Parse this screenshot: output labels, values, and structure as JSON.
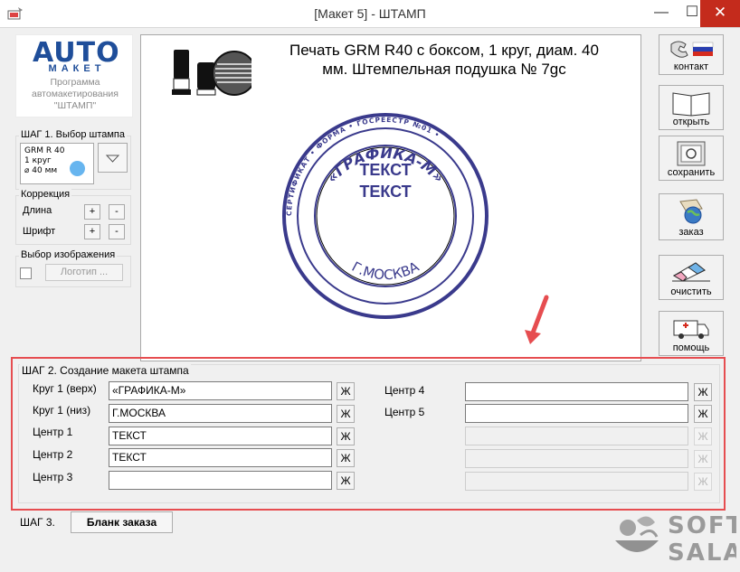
{
  "window": {
    "title": "[Макет 5] - ШТАМП",
    "minimize": "—",
    "maximize": "☐",
    "close": "✕"
  },
  "logo": {
    "auto": "AUTO",
    "maket": "МАКЕТ",
    "sub": "Программа автомакетирования \"ШТАМП\""
  },
  "step1": {
    "title": "ШАГ 1. Выбор штампа",
    "stamp_lines": [
      "GRM R 40",
      "1 круг",
      "⌀ 40 мм"
    ]
  },
  "correction": {
    "title": "Коррекция",
    "length_label": "Длина",
    "font_label": "Шрифт",
    "plus": "+",
    "minus": "-"
  },
  "image_select": {
    "title": "Выбор изображения",
    "logo_button": "Логотип ..."
  },
  "preview": {
    "title": "Печать GRM R40 с боксом, 1 круг, диам. 40 мм. Штемпельная подушка № 7gc",
    "stamp_top_text": "«ГРАФИКА-М»",
    "stamp_bottom_text": "Г.МОСКВА",
    "stamp_center_1": "ТЕКСТ",
    "stamp_center_2": "ТЕКСТ",
    "ring_text": "СЕРТИФИКАТ • ФОРМА • ГОСРЕЕСТР №01 •",
    "stamp_color": "#3a3a8c"
  },
  "right_buttons": {
    "contact": "контакт",
    "open": "открыть",
    "save": "сохранить",
    "order": "заказ",
    "clear": "очистить",
    "help": "помощь"
  },
  "step2": {
    "title": "ШАГ 2. Создание макета штампа",
    "bold_label": "Ж",
    "left_fields": [
      {
        "label": "Круг 1 (верх)",
        "value": "«ГРАФИКА-М»"
      },
      {
        "label": "Круг 1 (низ)",
        "value": "Г.МОСКВА"
      },
      {
        "label": "Центр 1",
        "value": "ТЕКСТ"
      },
      {
        "label": "Центр 2",
        "value": "ТЕКСТ"
      },
      {
        "label": "Центр 3",
        "value": ""
      }
    ],
    "right_fields": [
      {
        "label": "Центр 4",
        "value": ""
      },
      {
        "label": "Центр 5",
        "value": ""
      }
    ]
  },
  "step3": {
    "label": "ШАГ 3.",
    "button": "Бланк заказа"
  },
  "watermark": {
    "soft": "SOFT",
    "salad": "SALAD"
  },
  "colors": {
    "highlight": "#e64d50",
    "logo_blue": "#1f4e9a",
    "close_red": "#c42b1c"
  }
}
